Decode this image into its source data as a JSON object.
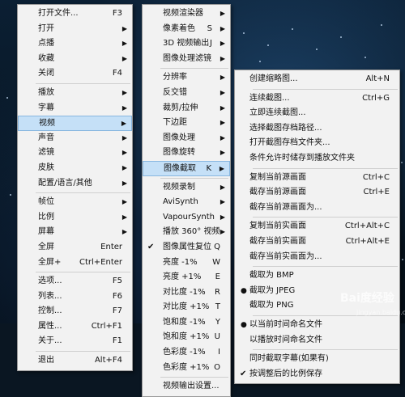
{
  "menu1": [
    {
      "label": "打开文件...",
      "shortcut": "F3"
    },
    {
      "label": "打开",
      "arrow": "▶"
    },
    {
      "label": "点播",
      "arrow": "▶"
    },
    {
      "label": "收藏",
      "arrow": "▶"
    },
    {
      "label": "关闭",
      "shortcut": "F4"
    },
    {
      "sep": true
    },
    {
      "label": "播放",
      "arrow": "▶"
    },
    {
      "label": "字幕",
      "arrow": "▶"
    },
    {
      "label": "视频",
      "arrow": "▶",
      "highlight": true
    },
    {
      "label": "声音",
      "arrow": "▶"
    },
    {
      "label": "滤镜",
      "arrow": "▶"
    },
    {
      "label": "皮肤",
      "arrow": "▶"
    },
    {
      "label": "配置/语言/其他",
      "arrow": "▶"
    },
    {
      "sep": true
    },
    {
      "label": "帧位",
      "arrow": "▶"
    },
    {
      "label": "比例",
      "arrow": "▶"
    },
    {
      "label": "屏幕",
      "arrow": "▶"
    },
    {
      "label": "全屏",
      "shortcut": "Enter"
    },
    {
      "label": "全屏+",
      "shortcut": "Ctrl+Enter"
    },
    {
      "sep": true
    },
    {
      "label": "选项...",
      "shortcut": "F5"
    },
    {
      "label": "列表...",
      "shortcut": "F6"
    },
    {
      "label": "控制...",
      "shortcut": "F7"
    },
    {
      "label": "属性...",
      "shortcut": "Ctrl+F1"
    },
    {
      "label": "关于...",
      "shortcut": "F1"
    },
    {
      "sep": true
    },
    {
      "label": "退出",
      "shortcut": "Alt+F4"
    }
  ],
  "menu2": [
    {
      "label": "视频渲染器",
      "arrow": "▶"
    },
    {
      "label": "像素着色",
      "shortcut": "S",
      "arrow": "▶"
    },
    {
      "label": "3D 视频输出",
      "shortcut": "J",
      "arrow": "▶"
    },
    {
      "label": "图像处理滤镜",
      "arrow": "▶"
    },
    {
      "sep": true
    },
    {
      "label": "分辨率",
      "arrow": "▶"
    },
    {
      "label": "反交错",
      "arrow": "▶"
    },
    {
      "label": "裁剪/拉伸",
      "arrow": "▶"
    },
    {
      "label": "下边距",
      "arrow": "▶"
    },
    {
      "label": "图像处理",
      "arrow": "▶"
    },
    {
      "label": "图像旋转",
      "arrow": "▶"
    },
    {
      "label": "图像截取",
      "shortcut": "K",
      "arrow": "▶",
      "highlight": true
    },
    {
      "sep": true
    },
    {
      "label": "视频录制",
      "arrow": "▶"
    },
    {
      "label": "AviSynth",
      "arrow": "▶"
    },
    {
      "label": "VapourSynth",
      "arrow": "▶"
    },
    {
      "label": "播放 360° 视频",
      "arrow": "▶"
    },
    {
      "label": "图像属性复位",
      "shortcut": "Q",
      "check": "✔"
    },
    {
      "label": "亮度 -1%",
      "shortcut": "W"
    },
    {
      "label": "亮度 +1%",
      "shortcut": "E"
    },
    {
      "label": "对比度 -1%",
      "shortcut": "R"
    },
    {
      "label": "对比度 +1%",
      "shortcut": "T"
    },
    {
      "label": "饱和度 -1%",
      "shortcut": "Y"
    },
    {
      "label": "饱和度 +1%",
      "shortcut": "U"
    },
    {
      "label": "色彩度 -1%",
      "shortcut": "I"
    },
    {
      "label": "色彩度 +1%",
      "shortcut": "O"
    },
    {
      "sep": true
    },
    {
      "label": "视频输出设置..."
    }
  ],
  "menu3": [
    {
      "label": "创建缩略图...",
      "shortcut": "Alt+N"
    },
    {
      "sep": true
    },
    {
      "label": "连续截图...",
      "shortcut": "Ctrl+G"
    },
    {
      "label": "立即连续截图..."
    },
    {
      "label": "选择截图存档路径..."
    },
    {
      "label": "打开截图存档文件夹..."
    },
    {
      "label": "条件允许时储存到播放文件夹"
    },
    {
      "sep": true
    },
    {
      "label": "复制当前源画面",
      "shortcut": "Ctrl+C"
    },
    {
      "label": "截存当前源画面",
      "shortcut": "Ctrl+E"
    },
    {
      "label": "截存当前源画面为..."
    },
    {
      "sep": true
    },
    {
      "label": "复制当前实画面",
      "shortcut": "Ctrl+Alt+C"
    },
    {
      "label": "截存当前实画面",
      "shortcut": "Ctrl+Alt+E"
    },
    {
      "label": "截存当前实画面为..."
    },
    {
      "sep": true
    },
    {
      "label": "截取为 BMP"
    },
    {
      "label": "截取为 JPEG",
      "bullet": "●"
    },
    {
      "label": "截取为 PNG"
    },
    {
      "sep": true
    },
    {
      "label": "以当前时间命名文件",
      "bullet": "●"
    },
    {
      "label": "以播放时间命名文件"
    },
    {
      "sep": true
    },
    {
      "label": "同时截取字幕(如果有)"
    },
    {
      "label": "按调整后的比例保存",
      "check": "✔"
    }
  ],
  "watermark": {
    "main": "Bai度经验",
    "sub": "jingyan.baidu.com"
  }
}
